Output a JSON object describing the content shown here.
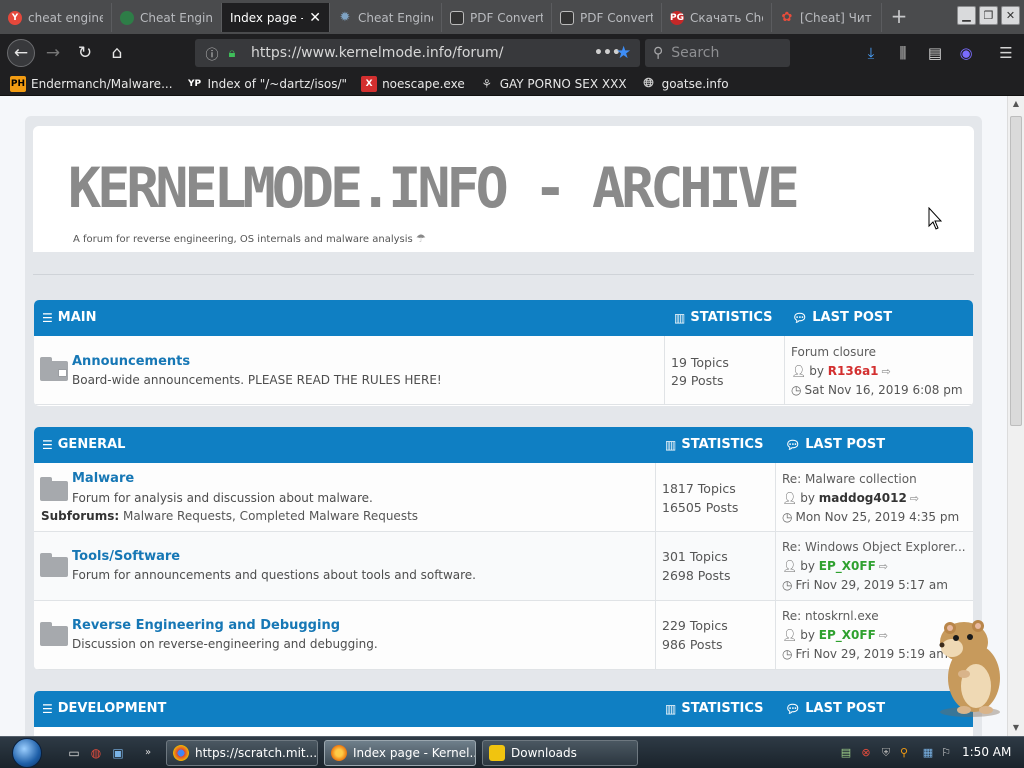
{
  "browser": {
    "tabs": [
      {
        "title": "cheat engine",
        "icon_label": "Y",
        "icon_color": "#e5483b",
        "active": false
      },
      {
        "title": "Cheat Engine",
        "icon_label": "",
        "icon_color": "#2e7d47",
        "active": false
      },
      {
        "title": "Index page - Ke",
        "icon_label": "",
        "icon_color": "",
        "active": true
      },
      {
        "title": "Cheat Engine",
        "icon_label": "",
        "icon_color": "#4b6b8a",
        "active": false
      },
      {
        "title": "PDF Converter",
        "icon_label": "",
        "icon_color": "#333333",
        "active": false
      },
      {
        "title": "PDF Converter",
        "icon_label": "",
        "icon_color": "#333333",
        "active": false
      },
      {
        "title": "Скачать Che",
        "icon_label": "PG",
        "icon_color": "#c62828",
        "active": false
      },
      {
        "title": "[Cheat] Чит",
        "icon_label": "",
        "icon_color": "#8e44ad",
        "active": false
      }
    ],
    "url": "https://www.kernelmode.info/forum/",
    "search_placeholder": "Search",
    "bookmarks": [
      {
        "label": "Endermanch/Malware...",
        "icon_label": "PH",
        "icon_color": "#f39c12"
      },
      {
        "label": "Index of \"/~dartz/isos/\"",
        "icon_label": "YP",
        "icon_color": "#1f1f21"
      },
      {
        "label": "noescape.exe",
        "icon_label": "X",
        "icon_color": "#d32f2f"
      },
      {
        "label": "GAY PORNO SEX XXX",
        "icon_label": "",
        "icon_color": "#cccccc"
      },
      {
        "label": "goatse.info",
        "icon_label": "",
        "icon_color": "#cccccc"
      }
    ]
  },
  "site": {
    "title": "KERNELMODE.INFO - ARCHIVE",
    "description": "A forum for reverse engineering, OS internals and malware analysis"
  },
  "categories": [
    {
      "name": "MAIN",
      "statistics_label": "STATISTICS",
      "last_post_label": "LAST POST",
      "forums": [
        {
          "title": "Announcements",
          "description": "Board-wide announcements. PLEASE READ THE RULES HERE!",
          "subforums_label": "",
          "subforums": "",
          "topics": "19 Topics",
          "posts": "29 Posts",
          "last_title": "Forum closure",
          "by_label": "by",
          "last_author": "R136a1",
          "author_color": "#d32f2f",
          "last_time": "Sat Nov 16, 2019 6:08 pm",
          "locked": true
        }
      ]
    },
    {
      "name": "GENERAL",
      "statistics_label": "STATISTICS",
      "last_post_label": "LAST POST",
      "forums": [
        {
          "title": "Malware",
          "description": "Forum for analysis and discussion about malware.",
          "subforums_label": "Subforums:",
          "subforums": "Malware Requests, Completed Malware Requests",
          "topics": "1817 Topics",
          "posts": "16505 Posts",
          "last_title": "Re: Malware collection",
          "by_label": "by",
          "last_author": "maddog4012",
          "author_color": "#333333",
          "last_time": "Mon Nov 25, 2019 4:35 pm",
          "locked": false
        },
        {
          "title": "Tools/Software",
          "description": "Forum for announcements and questions about tools and software.",
          "subforums_label": "",
          "subforums": "",
          "topics": "301 Topics",
          "posts": "2698 Posts",
          "last_title": "Re: Windows Object Explorer...",
          "by_label": "by",
          "last_author": "EP_X0FF",
          "author_color": "#2fa12f",
          "last_time": "Fri Nov 29, 2019 5:17 am",
          "locked": false
        },
        {
          "title": "Reverse Engineering and Debugging",
          "description": "Discussion on reverse-engineering and debugging.",
          "subforums_label": "",
          "subforums": "",
          "topics": "229 Topics",
          "posts": "986 Posts",
          "last_title": "Re: ntoskrnl.exe",
          "by_label": "by",
          "last_author": "EP_X0FF",
          "author_color": "#2fa12f",
          "last_time": "Fri Nov 29, 2019 5:19 am",
          "locked": false
        }
      ]
    },
    {
      "name": "DEVELOPMENT",
      "statistics_label": "STATISTICS",
      "last_post_label": "LAST POST",
      "forums": []
    }
  ],
  "taskbar": {
    "tasks": [
      {
        "label": "https://scratch.mit....",
        "icon_color": "#db4437",
        "active": false
      },
      {
        "label": "Index page - Kernel...",
        "icon_color": "#e67e22",
        "active": true
      },
      {
        "label": "Downloads",
        "icon_color": "#f1c40f",
        "active": false
      }
    ],
    "clock": "1:50 AM"
  }
}
